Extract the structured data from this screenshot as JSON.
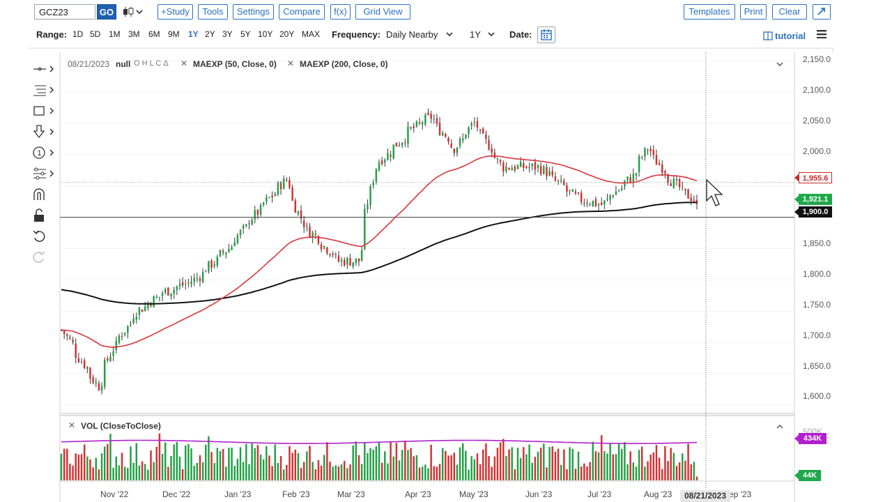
{
  "toolbar": {
    "symbol": "GCZ23",
    "go_label": "GO",
    "study_label": "+Study",
    "tools_label": "Tools",
    "settings_label": "Settings",
    "compare_label": "Compare",
    "fx_label": "f(x)",
    "gridview_label": "Grid View",
    "templates_label": "Templates",
    "print_label": "Print",
    "clear_label": "Clear"
  },
  "rangebar": {
    "range_label": "Range:",
    "ranges": [
      "1D",
      "5D",
      "1M",
      "3M",
      "6M",
      "9M",
      "1Y",
      "2Y",
      "3Y",
      "5Y",
      "10Y",
      "20Y",
      "MAX"
    ],
    "active_range": "1Y",
    "frequency_label": "Frequency:",
    "frequency_value": "Daily Nearby",
    "period_value": "1Y",
    "date_label": "Date:",
    "tutorial_label": "tutorial"
  },
  "legend": {
    "date": "08/21/2023",
    "ohlc": "null",
    "ohlc_fields": "O H L C Δ",
    "ma1": "MAEXP (50, Close, 0)",
    "ma2": "MAEXP (200, Close, 0)",
    "vol": "VOL (CloseToClose)"
  },
  "price_axis": {
    "ticks": [
      "2,150.0",
      "2,100.0",
      "2,050.0",
      "2,000.0",
      "1,850.0",
      "1,800.0",
      "1,750.0",
      "1,700.0",
      "1,650.0",
      "1,600.0"
    ],
    "badge_ma50": "1,955.6",
    "badge_last": "1,921.1",
    "badge_level": "1,900.0",
    "vol_partial_tick": "500K",
    "badge_vol_ma": "434K",
    "badge_vol_last": "44K"
  },
  "time_axis": {
    "ticks": [
      "Nov '22",
      "Dec '22",
      "Jan '23",
      "Feb '23",
      "Mar '23",
      "Apr '23",
      "May '23",
      "Jun '23",
      "Jul '23",
      "Aug '23",
      "Sep '23"
    ],
    "crosshair_date": "08/21/2023"
  },
  "colors": {
    "up": "#22a046",
    "down": "#d23131",
    "ma50": "#d9343a",
    "ma200": "#111111",
    "volma": "#b11fcf",
    "accent": "#2a6fc2",
    "go": "#1f5fb0"
  },
  "chart_data": {
    "type": "candlestick",
    "title": "",
    "y_range": [
      1590,
      2160
    ],
    "y_tick_values": [
      2150,
      2100,
      2050,
      2000,
      1950,
      1900,
      1850,
      1800,
      1750,
      1700,
      1650,
      1600
    ],
    "horizontal_level": 1900,
    "close_anchors": {
      "dates": [
        "2022-10-17",
        "2022-10-26",
        "2022-11-03",
        "2022-11-10",
        "2022-11-22",
        "2022-12-05",
        "2022-12-20",
        "2023-01-05",
        "2023-01-17",
        "2023-02-02",
        "2023-02-10",
        "2023-02-28",
        "2023-03-09",
        "2023-03-17",
        "2023-04-04",
        "2023-04-13",
        "2023-04-25",
        "2023-05-04",
        "2023-05-18",
        "2023-06-05",
        "2023-06-23",
        "2023-07-05",
        "2023-07-20",
        "2023-07-27",
        "2023-08-10",
        "2023-08-21"
      ],
      "closes": [
        1720,
        1670,
        1630,
        1690,
        1750,
        1780,
        1800,
        1850,
        1900,
        1960,
        1890,
        1830,
        1830,
        1980,
        2040,
        2060,
        2010,
        2050,
        1980,
        1980,
        1930,
        1920,
        1965,
        2010,
        1950,
        1921.1
      ]
    },
    "last_close": 1921.1,
    "ma50_last": 1955.6,
    "series": [
      {
        "name": "MAEXP (50, Close, 0)"
      },
      {
        "name": "MAEXP (200, Close, 0)"
      }
    ],
    "volume": {
      "name": "VOL (CloseToClose)",
      "ma_last_k": 434,
      "last_k": 44
    }
  }
}
